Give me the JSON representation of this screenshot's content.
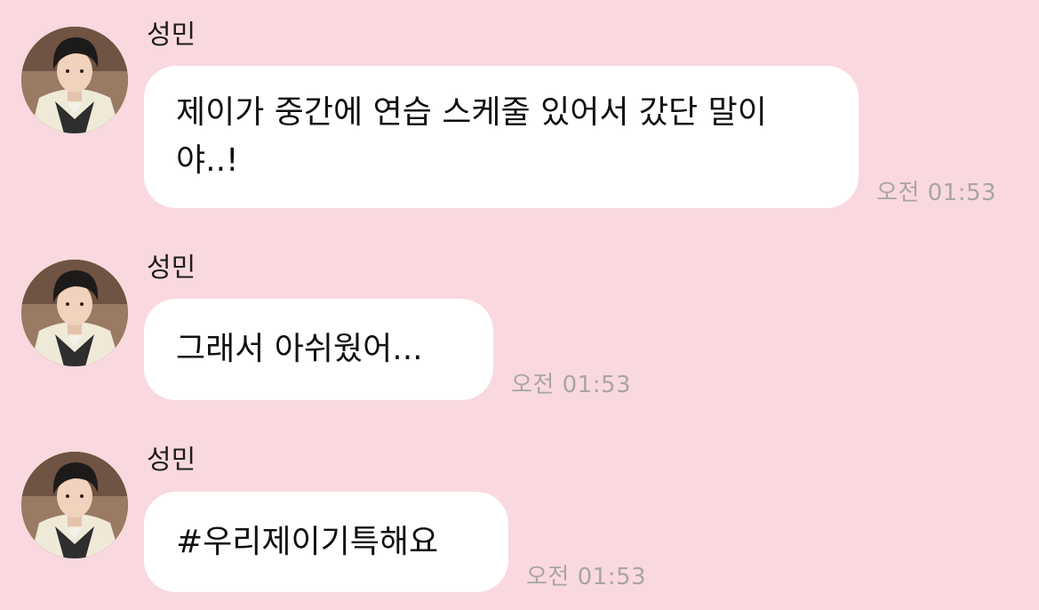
{
  "messages": [
    {
      "sender": "성민",
      "text": "제이가 중간에 연습 스케줄 있어서 갔단 말이야..!",
      "time": "오전 01:53"
    },
    {
      "sender": "성민",
      "text": "그래서 아쉬웠어...",
      "time": "오전 01:53"
    },
    {
      "sender": "성민",
      "text": "#우리제이기특해요",
      "time": "오전 01:53"
    }
  ],
  "colors": {
    "background": "#f9d9df",
    "bubble": "#ffffff",
    "time_text": "#a9a4a6"
  },
  "icons": {
    "avatar": "profile-photo"
  }
}
